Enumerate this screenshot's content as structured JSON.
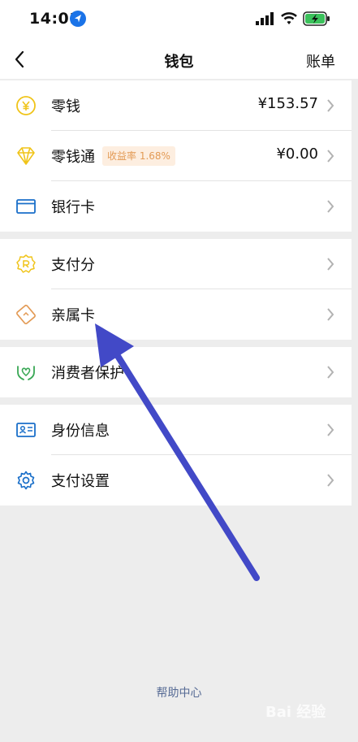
{
  "status_bar": {
    "time": "14:01"
  },
  "header": {
    "title": "钱包",
    "right_action": "账单"
  },
  "groups": [
    {
      "items": [
        {
          "label": "零钱",
          "value": "¥153.57",
          "icon": "yen-coin-icon"
        },
        {
          "label": "零钱通",
          "badge": "收益率 1.68%",
          "value": "¥0.00",
          "icon": "diamond-icon"
        },
        {
          "label": "银行卡",
          "icon": "bank-card-icon"
        }
      ]
    },
    {
      "items": [
        {
          "label": "支付分",
          "icon": "credit-score-icon"
        },
        {
          "label": "亲属卡",
          "icon": "family-card-icon"
        }
      ]
    },
    {
      "items": [
        {
          "label": "消费者保护",
          "icon": "consumer-protection-icon"
        }
      ]
    },
    {
      "items": [
        {
          "label": "身份信息",
          "icon": "id-card-icon"
        },
        {
          "label": "支付设置",
          "icon": "gear-icon"
        }
      ]
    }
  ],
  "footer": {
    "help_link": "帮助中心"
  },
  "watermark": "Bai 经验",
  "colors": {
    "accent_yellow": "#f0c419",
    "accent_blue": "#1a6fc9",
    "arrow": "#4249c7",
    "link": "#576b95"
  }
}
